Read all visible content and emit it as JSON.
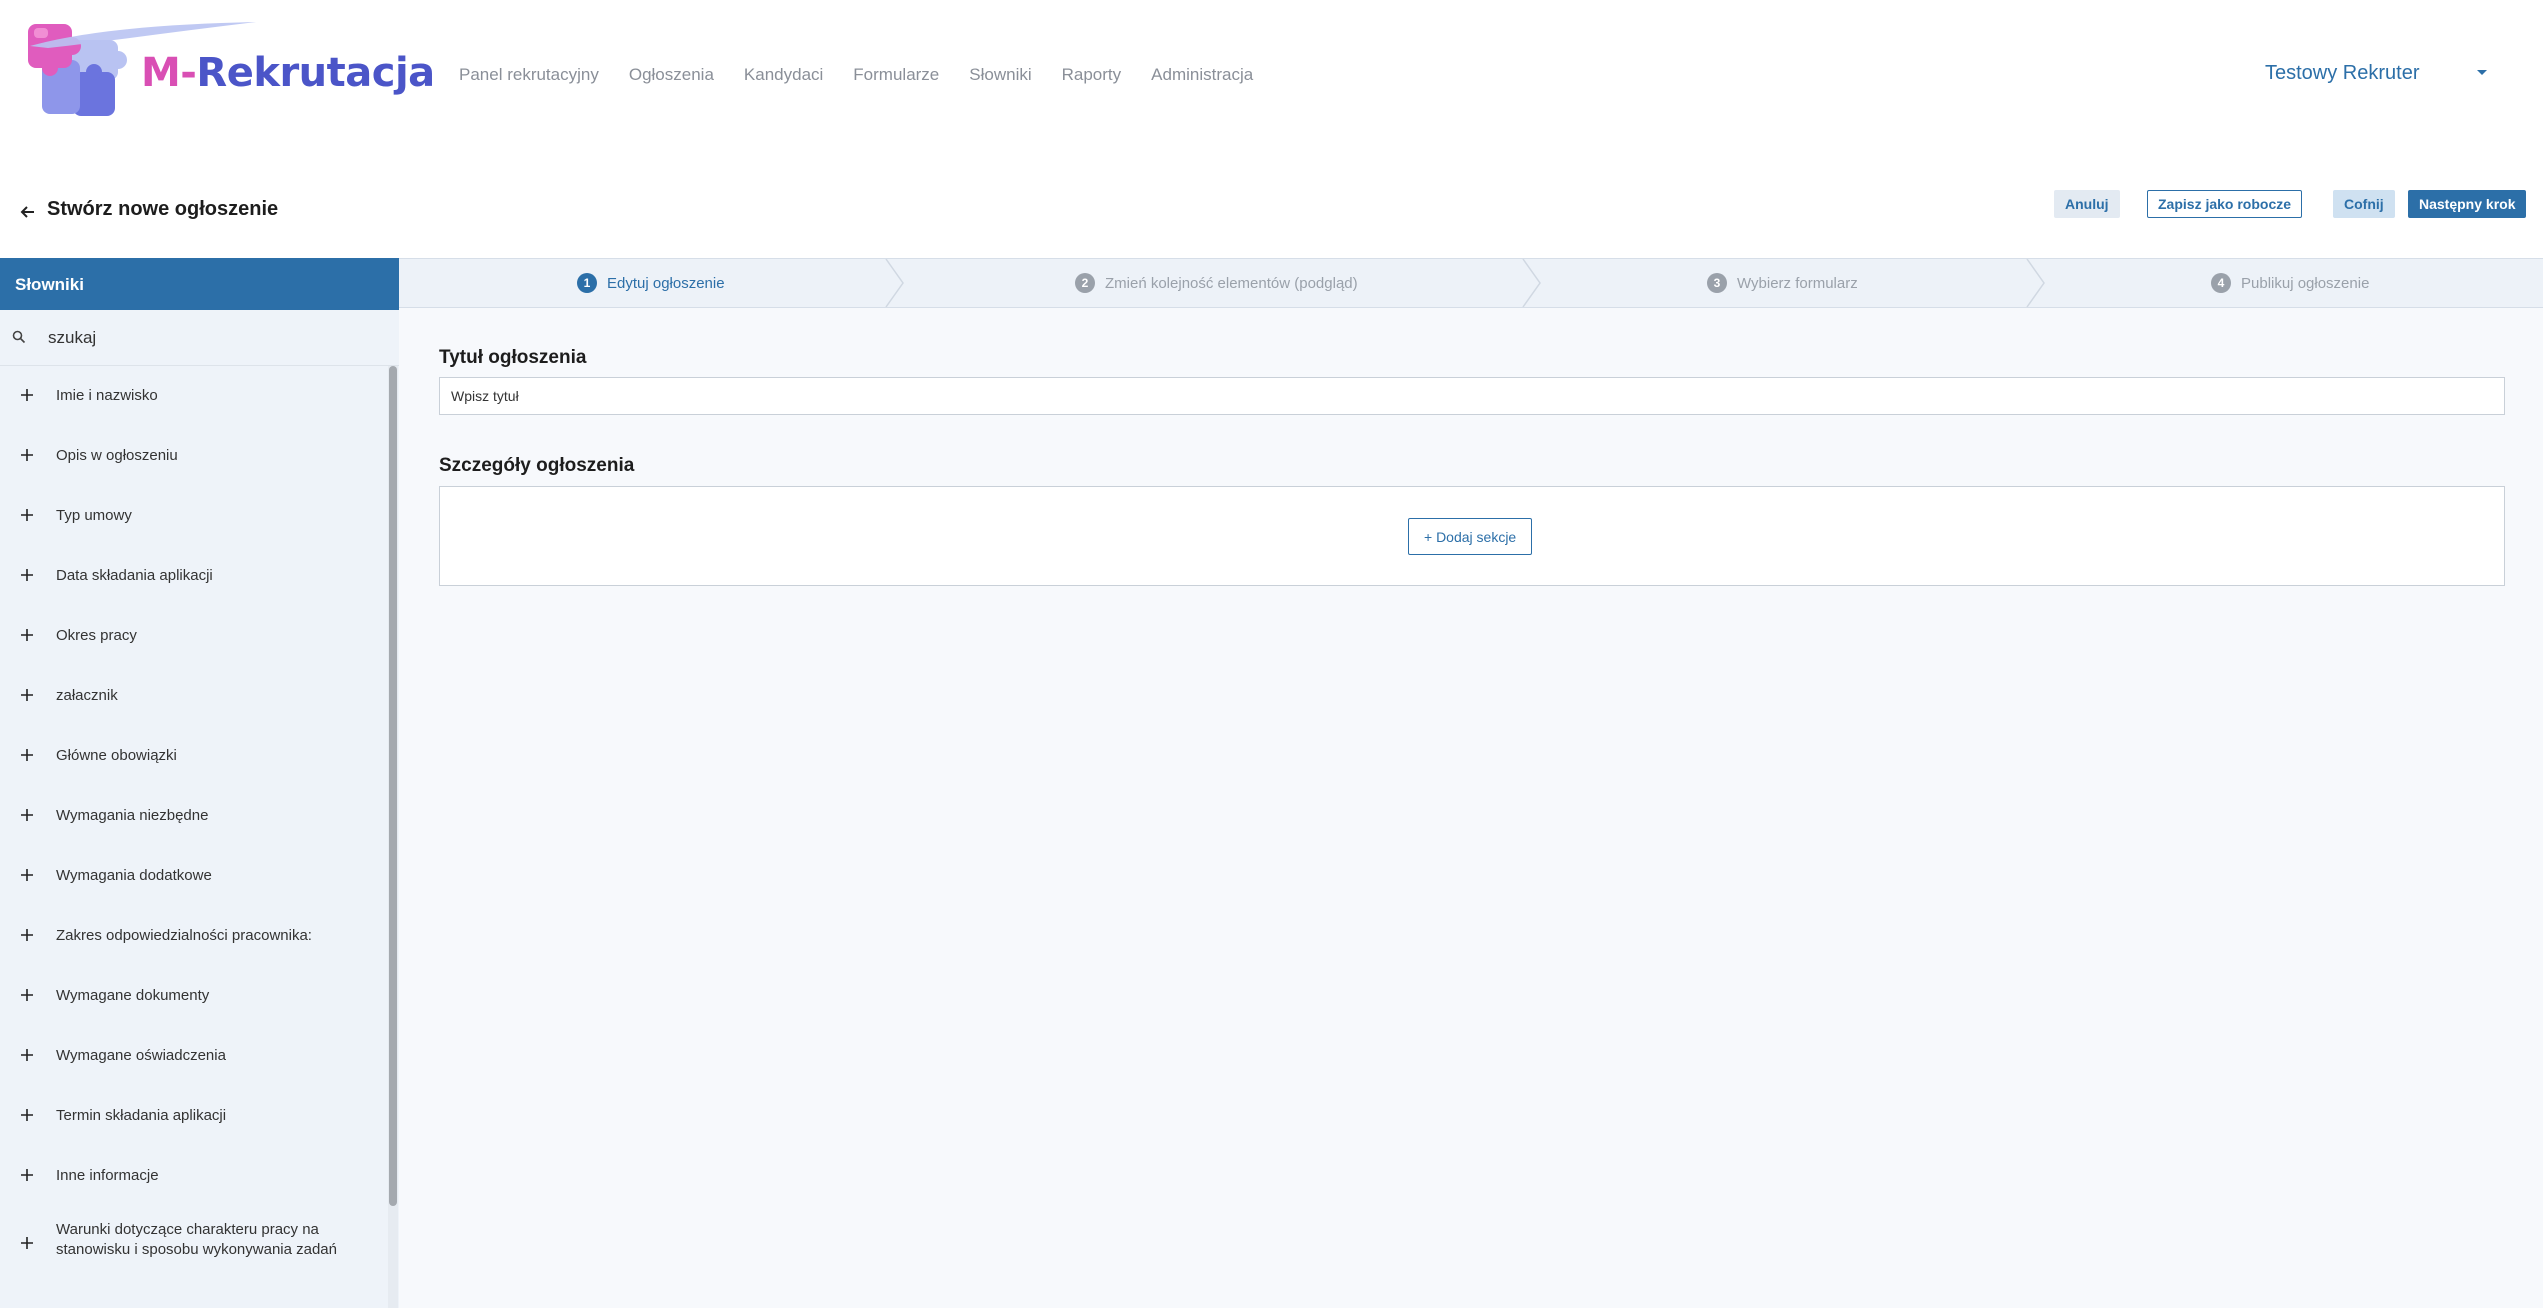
{
  "brand": {
    "name_prefix": "M-",
    "name_rest": "Rekrutacja",
    "colors": {
      "pink": "#d94fb4",
      "indigo": "#4b55c8"
    }
  },
  "nav": {
    "items": [
      {
        "label": "Panel rekrutacyjny"
      },
      {
        "label": "Ogłoszenia"
      },
      {
        "label": "Kandydaci"
      },
      {
        "label": "Formularze"
      },
      {
        "label": "Słowniki"
      },
      {
        "label": "Raporty"
      },
      {
        "label": "Administracja"
      }
    ]
  },
  "user": {
    "name": "Testowy Rekruter",
    "menu_icon": "caret-down-icon"
  },
  "page": {
    "title": "Stwórz nowe ogłoszenie",
    "back_icon": "arrow-left-icon"
  },
  "actions": {
    "cancel": "Anuluj",
    "save_draft": "Zapisz jako robocze",
    "back": "Cofnij",
    "next": "Następny krok"
  },
  "sidebar": {
    "title": "Słowniki",
    "search_placeholder": "szukaj",
    "items": [
      {
        "label": "Imie i nazwisko"
      },
      {
        "label": "Opis w ogłoszeniu"
      },
      {
        "label": "Typ umowy"
      },
      {
        "label": "Data składania aplikacji"
      },
      {
        "label": "Okres pracy"
      },
      {
        "label": "załacznik"
      },
      {
        "label": "Główne obowiązki"
      },
      {
        "label": "Wymagania niezbędne"
      },
      {
        "label": "Wymagania dodatkowe"
      },
      {
        "label": "Zakres odpowiedzialności pracownika:"
      },
      {
        "label": "Wymagane dokumenty"
      },
      {
        "label": "Wymagane oświadczenia"
      },
      {
        "label": "Termin składania aplikacji"
      },
      {
        "label": "Inne informacje"
      },
      {
        "label": "Warunki dotyczące charakteru pracy na stanowisku i sposobu wykonywania zadań"
      }
    ]
  },
  "stepper": {
    "steps": [
      {
        "num": "1",
        "label": "Edytuj ogłoszenie"
      },
      {
        "num": "2",
        "label": "Zmień kolejność elementów (podgląd)"
      },
      {
        "num": "3",
        "label": "Wybierz formularz"
      },
      {
        "num": "4",
        "label": "Publikuj ogłoszenie"
      }
    ],
    "active_step": 1
  },
  "form": {
    "title_label": "Tytuł ogłoszenia",
    "title_placeholder": "Wpisz tytuł",
    "title_value": "",
    "details_label": "Szczegóły ogłoszenia",
    "add_section": "+ Dodaj sekcje"
  },
  "colors": {
    "primary": "#2c6fa8",
    "sidebar_bg": "#eef3f9",
    "main_bg": "#f7f9fc",
    "muted_text": "#8a8f98"
  }
}
